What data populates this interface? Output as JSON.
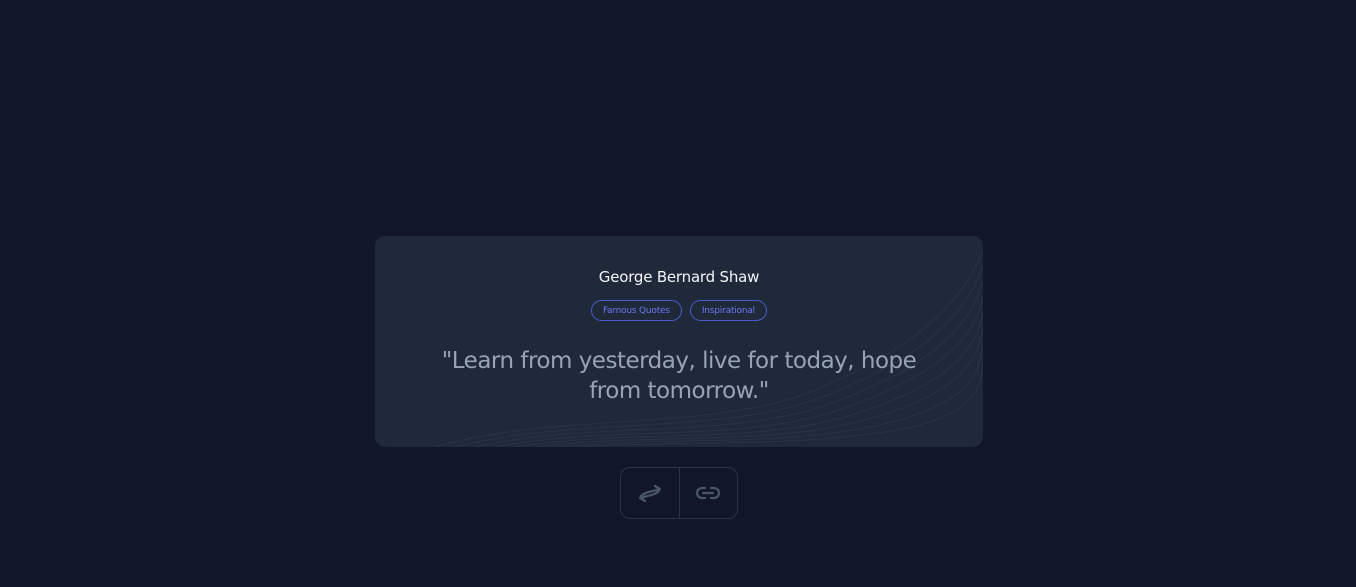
{
  "quote_card": {
    "author": "George Bernard Shaw",
    "tags": [
      "Famous Quotes",
      "Inspirational"
    ],
    "text": "\"Learn from yesterday, live for today, hope from tomorrow.\""
  },
  "actions": {
    "shuffle_icon": "shuffle-arrows-icon",
    "link_icon": "link-icon"
  },
  "colors": {
    "background": "#111729",
    "card": "#20293a",
    "accent": "#4a5ccc",
    "quote_text": "#97a3b6",
    "author_text": "#f2f5f9",
    "icon": "#4a5567"
  }
}
